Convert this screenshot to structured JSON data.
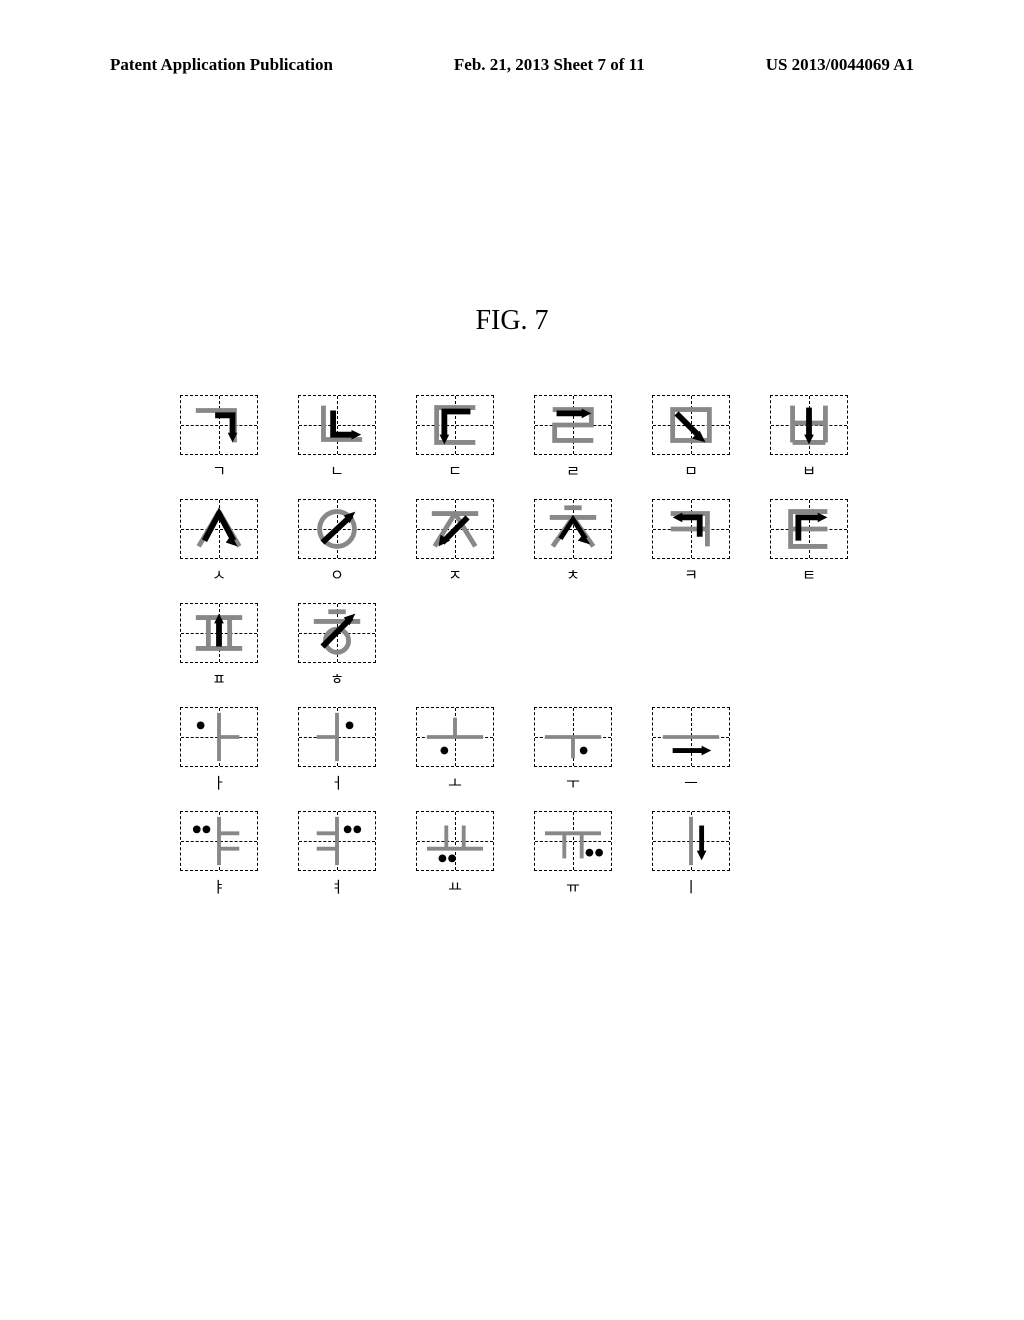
{
  "header": {
    "left": "Patent Application Publication",
    "center": "Feb. 21, 2013  Sheet 7 of 11",
    "right": "US 2013/0044069 A1"
  },
  "figure_label": "FIG. 7",
  "rows": [
    [
      {
        "char": "ㄱ",
        "svg": "<path d='M15 15 L55 15 L55 48' fill='none' stroke='#888' stroke-width='5'/><path d='M35 20 L53 20 L53 42' fill='none' stroke='#000' stroke-width='6'/><polygon points='53,48 48,38 58,38' fill='#000'/>"
      },
      {
        "char": "ㄴ",
        "svg": "<path d='M25 10 L25 45 L65 45' fill='none' stroke='#888' stroke-width='5'/><path d='M35 15 L35 40 L58 40' fill='none' stroke='#000' stroke-width='6'/><polygon points='64,40 54,35 54,45' fill='#000'/>"
      },
      {
        "char": "ㄷ",
        "svg": "<path d='M60 12 L20 12 L20 48 L60 48' fill='none' stroke='#888' stroke-width='5'/><path d='M55 16 L28 16 L28 44' fill='none' stroke='#000' stroke-width='6'/><polygon points='28,50 23,40 33,40' fill='#000'/>"
      },
      {
        "char": "ㄹ",
        "svg": "<path d='M18 14 L58 14 L58 30 L20 30 L20 46 L60 46' fill='none' stroke='#888' stroke-width='5'/><path d='M22 18 L50 18' fill='none' stroke='#000' stroke-width='6'/><polygon points='58,18 48,13 48,23' fill='#000'/>"
      },
      {
        "char": "ㅁ",
        "svg": "<rect x='20' y='14' width='38' height='32' fill='none' stroke='#888' stroke-width='5'/><path d='M24 18 L48 42' fill='none' stroke='#000' stroke-width='6'/><polygon points='54,48 40,44 48,36' fill='#000'/>"
      },
      {
        "char": "ㅂ",
        "svg": "<path d='M22 10 L22 48 M56 10 L56 48 M22 28 L56 28 M22 48 L56 48' fill='none' stroke='#888' stroke-width='5'/><path d='M39 12 L39 42' fill='none' stroke='#000' stroke-width='6'/><polygon points='39,50 34,40 44,40' fill='#000'/>"
      }
    ],
    [
      {
        "char": "ㅅ",
        "svg": "<path d='M39 12 L18 48 M39 12 L60 48' fill='none' stroke='#888' stroke-width='5'/><path d='M24 42 L39 14 L54 42' fill='none' stroke='#000' stroke-width='6'/><polygon points='39,8 34,18 44,18' fill='#000'/><polygon points='58,48 46,44 52,36' fill='#000'/>"
      },
      {
        "char": "ㅇ",
        "svg": "<circle cx='39' cy='30' r='18' fill='none' stroke='#888' stroke-width='5'/><path d='M24 44 L54 16' fill='none' stroke='#000' stroke-width='6'/><polygon points='58,12 46,16 52,24' fill='#000'/>"
      },
      {
        "char": "ㅈ",
        "svg": "<path d='M15 14 L63 14 M39 14 L18 48 M39 14 L60 48' fill='none' stroke='#888' stroke-width='5'/><path d='M52 18 L26 44' fill='none' stroke='#000' stroke-width='6'/><polygon points='22,48 24,36 34,42' fill='#000'/>"
      },
      {
        "char": "ㅊ",
        "svg": "<path d='M30 8 L48 8 M15 18 L63 18 M39 18 L18 48 M39 18 L60 48' fill='none' stroke='#888' stroke-width='5'/><path d='M26 40 L39 20 L52 40' fill='none' stroke='#000' stroke-width='5'/><polygon points='57,46 44,42 50,35' fill='#000'/>"
      },
      {
        "char": "ㅋ",
        "svg": "<path d='M18 14 L56 14 L56 48 M18 30 L56 30' fill='none' stroke='#888' stroke-width='5'/><path d='M48 38 L48 18 L26 18' fill='none' stroke='#000' stroke-width='6'/><polygon points='20,18 30,13 30,23' fill='#000'/>"
      },
      {
        "char": "ㅌ",
        "svg": "<path d='M58 12 L20 12 L20 48 L58 48 M20 30 L58 30' fill='none' stroke='#888' stroke-width='5'/><path d='M28 42 L28 18 L52 18' fill='none' stroke='#000' stroke-width='6'/><polygon points='58,18 48,13 48,23' fill='#000'/>"
      }
    ],
    [
      {
        "char": "ㅍ",
        "svg": "<path d='M15 14 L63 14 M15 46 L63 46 M28 14 L28 46 M50 14 L50 46' fill='none' stroke='#888' stroke-width='5'/><path d='M39 44 L39 16' fill='none' stroke='#000' stroke-width='6'/><polygon points='39,10 34,20 44,20' fill='#000'/>"
      },
      {
        "char": "ㅎ",
        "svg": "<path d='M30 8 L48 8 M15 18 L63 18' fill='none' stroke='#888' stroke-width='5'/><circle cx='39' cy='38' r='12' fill='none' stroke='#888' stroke-width='5'/><path d='M24 44 L54 14' fill='none' stroke='#000' stroke-width='6'/><polygon points='58,10 46,14 52,22' fill='#000'/>"
      }
    ],
    [
      {
        "char": "ㅏ",
        "svg": "<path d='M39 5 L39 55 M39 30 L60 30' fill='none' stroke='#888' stroke-width='4'/><circle cx='20' cy='18' r='4' fill='#000'/>"
      },
      {
        "char": "ㅓ",
        "svg": "<path d='M39 5 L39 55 M18 30 L39 30' fill='none' stroke='#888' stroke-width='4'/><circle cx='52' cy='18' r='4' fill='#000'/>"
      },
      {
        "char": "ㅗ",
        "svg": "<path d='M10 30 L68 30 M39 10 L39 30' fill='none' stroke='#888' stroke-width='4'/><circle cx='28' cy='44' r='4' fill='#000'/>"
      },
      {
        "char": "ㅜ",
        "svg": "<path d='M10 30 L68 30 M39 30 L39 52' fill='none' stroke='#888' stroke-width='4'/><circle cx='50' cy='44' r='4' fill='#000'/>"
      },
      {
        "char": "ㅡ",
        "svg": "<path d='M10 30 L68 30' fill='none' stroke='#888' stroke-width='4'/><path d='M20 44 L54 44' fill='none' stroke='#000' stroke-width='5'/><polygon points='60,44 50,39 50,49' fill='#000'/>"
      }
    ],
    [
      {
        "char": "ㅑ",
        "svg": "<path d='M39 5 L39 55 M39 22 L60 22 M39 38 L60 38' fill='none' stroke='#888' stroke-width='4'/><circle cx='16' cy='18' r='4' fill='#000'/><circle cx='26' cy='18' r='4' fill='#000'/>"
      },
      {
        "char": "ㅕ",
        "svg": "<path d='M39 5 L39 55 M18 22 L39 22 M18 38 L39 38' fill='none' stroke='#888' stroke-width='4'/><circle cx='50' cy='18' r='4' fill='#000'/><circle cx='60' cy='18' r='4' fill='#000'/>"
      },
      {
        "char": "ㅛ",
        "svg": "<path d='M10 38 L68 38 M30 14 L30 38 M48 14 L48 38' fill='none' stroke='#888' stroke-width='4'/><circle cx='26' cy='48' r='4' fill='#000'/><circle cx='36' cy='48' r='4' fill='#000'/>"
      },
      {
        "char": "ㅠ",
        "svg": "<path d='M10 22 L68 22 M30 22 L30 48 M48 22 L48 48' fill='none' stroke='#888' stroke-width='4'/><circle cx='56' cy='42' r='4' fill='#000'/><circle cx='66' cy='42' r='4' fill='#000'/>"
      },
      {
        "char": "ㅣ",
        "svg": "<path d='M39 5 L39 55' fill='none' stroke='#888' stroke-width='4'/><path d='M50 14 L50 44' fill='none' stroke='#000' stroke-width='5'/><polygon points='50,50 45,40 55,40' fill='#000'/>"
      }
    ]
  ]
}
